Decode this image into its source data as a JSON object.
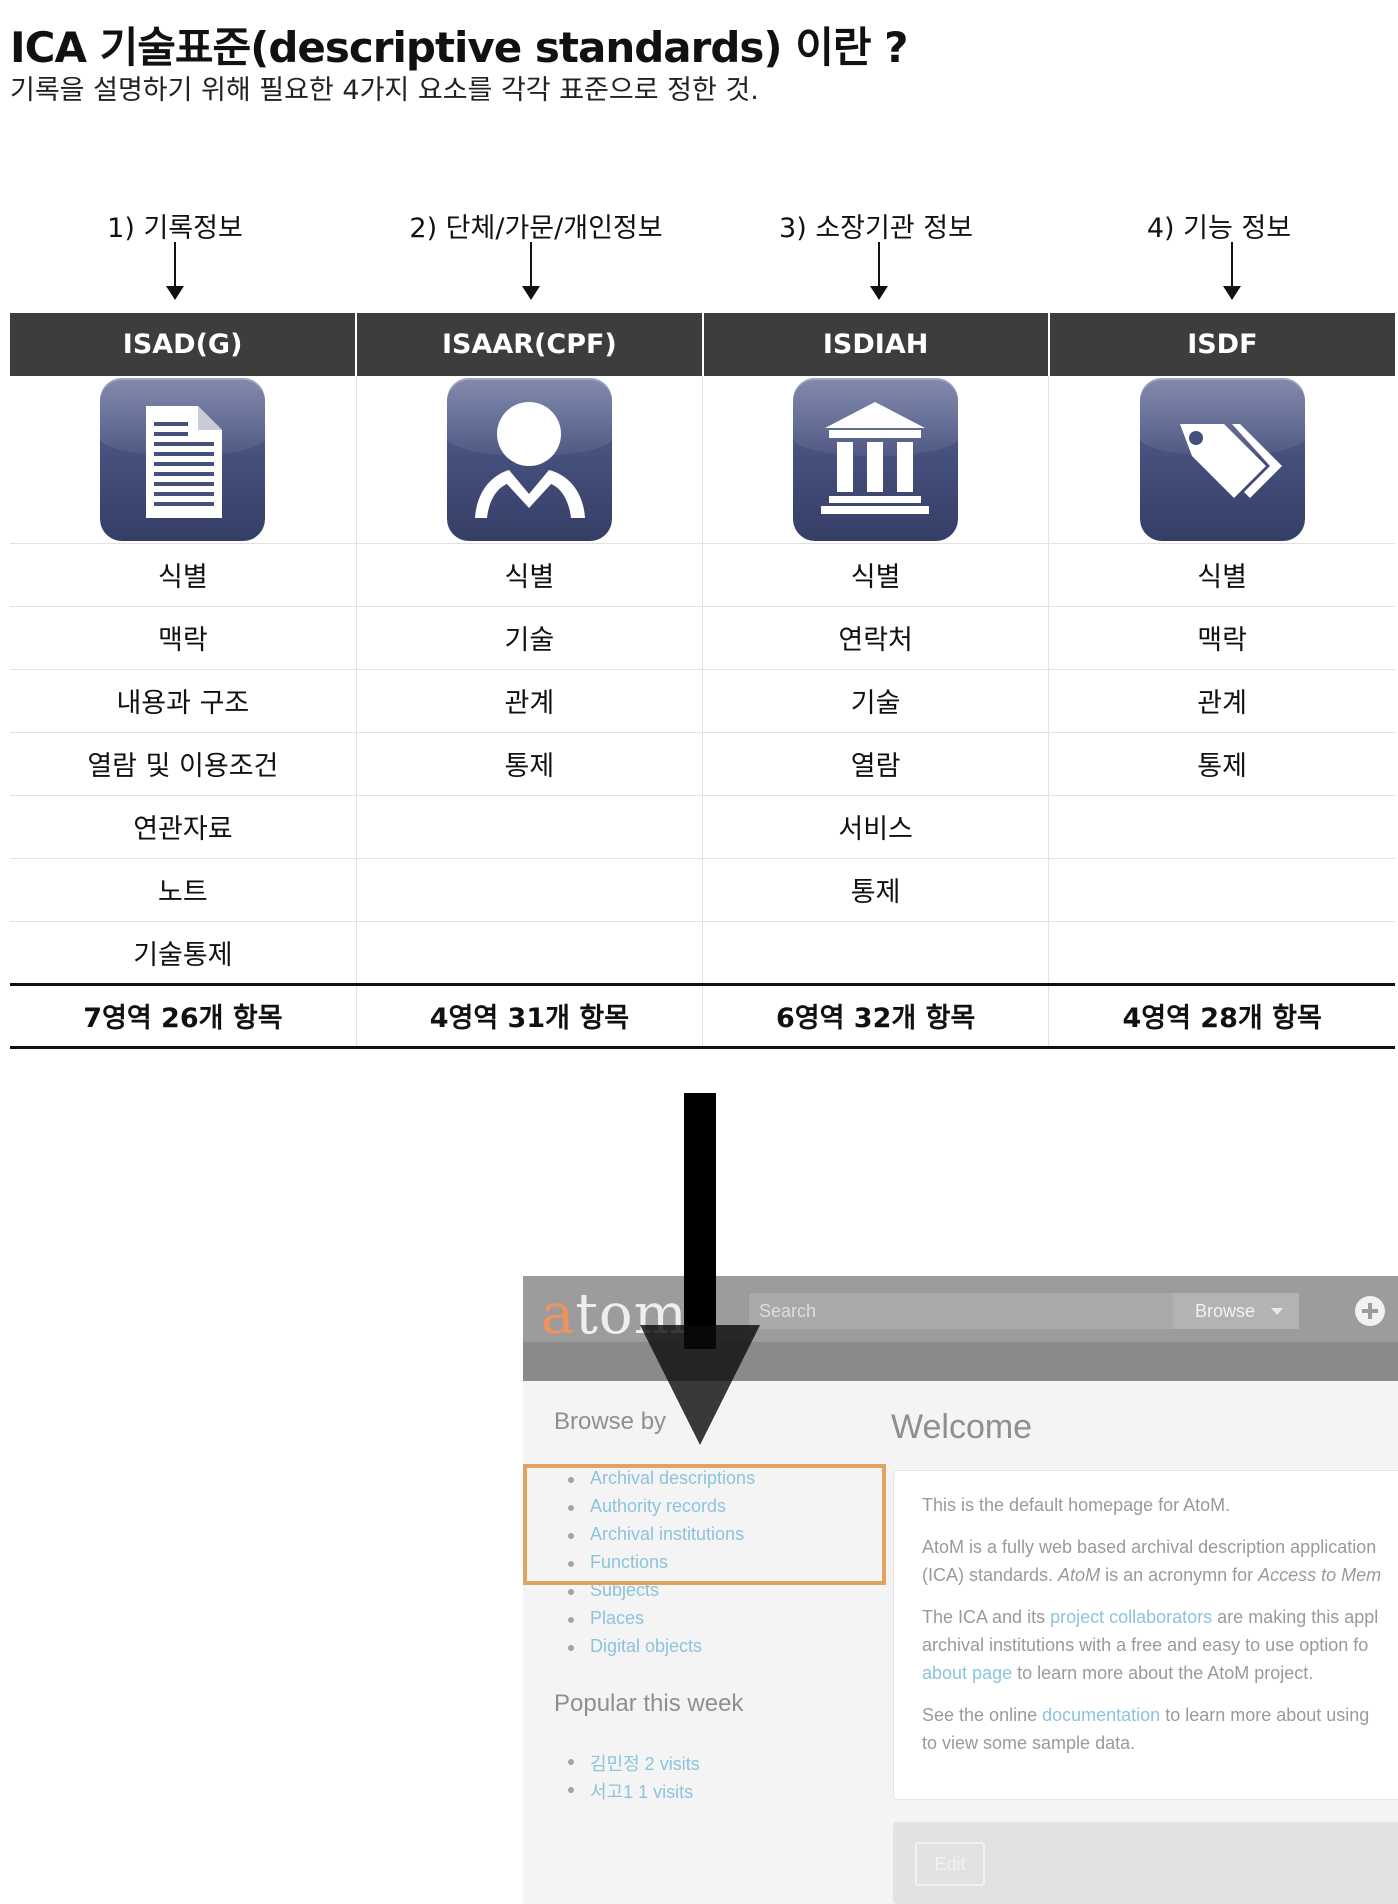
{
  "header": {
    "title": "ICA 기술표준(descriptive standards) 이란 ?",
    "subtitle": "기록을 설명하기 위해 필요한 4가지 요소를 각각 표준으로 정한 것."
  },
  "categories": [
    "1) 기록정보",
    "2) 단체/가문/개인정보",
    "3) 소장기관 정보",
    "4) 기능 정보"
  ],
  "standards": {
    "headers": [
      "ISAD(G)",
      "ISAAR(CPF)",
      "ISDIAH",
      "ISDF"
    ],
    "icons": [
      "document-icon",
      "person-icon",
      "institution-icon",
      "tag-icon"
    ],
    "rows": [
      [
        "식별",
        "식별",
        "식별",
        "식별"
      ],
      [
        "맥락",
        "기술",
        "연락처",
        "맥락"
      ],
      [
        "내용과 구조",
        "관계",
        "기술",
        "관계"
      ],
      [
        "열람 및 이용조건",
        "통제",
        "열람",
        "통제"
      ],
      [
        "연관자료",
        "",
        "서비스",
        ""
      ],
      [
        "노트",
        "",
        "통제",
        ""
      ],
      [
        "기술통제",
        "",
        "",
        ""
      ]
    ],
    "totals": [
      "7영역 26개 항목",
      "4영역 31개 항목",
      "6영역 32개 항목",
      "4영역 28개 항목"
    ]
  },
  "atom": {
    "logo_first": "a",
    "logo_rest": "tom",
    "search_placeholder": "Search",
    "browse_label": "Browse",
    "browse_heading": "Browse by",
    "browse_items": [
      "Archival descriptions",
      "Authority records",
      "Archival institutions",
      "Functions",
      "Subjects",
      "Places",
      "Digital objects"
    ],
    "popular_heading": "Popular this week",
    "popular_items": [
      "김민정 2 visits",
      "서고1 1 visits"
    ],
    "welcome_title": "Welcome",
    "content": {
      "p1": "This is the default homepage for AtoM.",
      "p2_line1": "AtoM is a fully web based archival description application",
      "p2_line2_a": "(ICA) standards. ",
      "p2_line2_b": "AtoM",
      "p2_line2_c": " is an acronymn for ",
      "p2_line2_d": "Access to Mem",
      "p3_line1_a": "The ICA and its ",
      "p3_line1_link": "project collaborators",
      "p3_line1_b": " are making this appl",
      "p3_line2": "archival institutions with a free and easy to use option fo",
      "p3_line3_link": "about page",
      "p3_line3_b": " to learn more about the AtoM project.",
      "p4_line1_a": "See the online ",
      "p4_line1_link": "documentation",
      "p4_line1_b": " to learn more about using",
      "p4_line2": "to view some sample data."
    },
    "edit_label": "Edit",
    "highlight_color": "#e0a360",
    "link_color": "#8cc3dd"
  },
  "colors": {
    "table_header_bg": "#3d3d3d",
    "icon_bg": "#454f7c"
  }
}
